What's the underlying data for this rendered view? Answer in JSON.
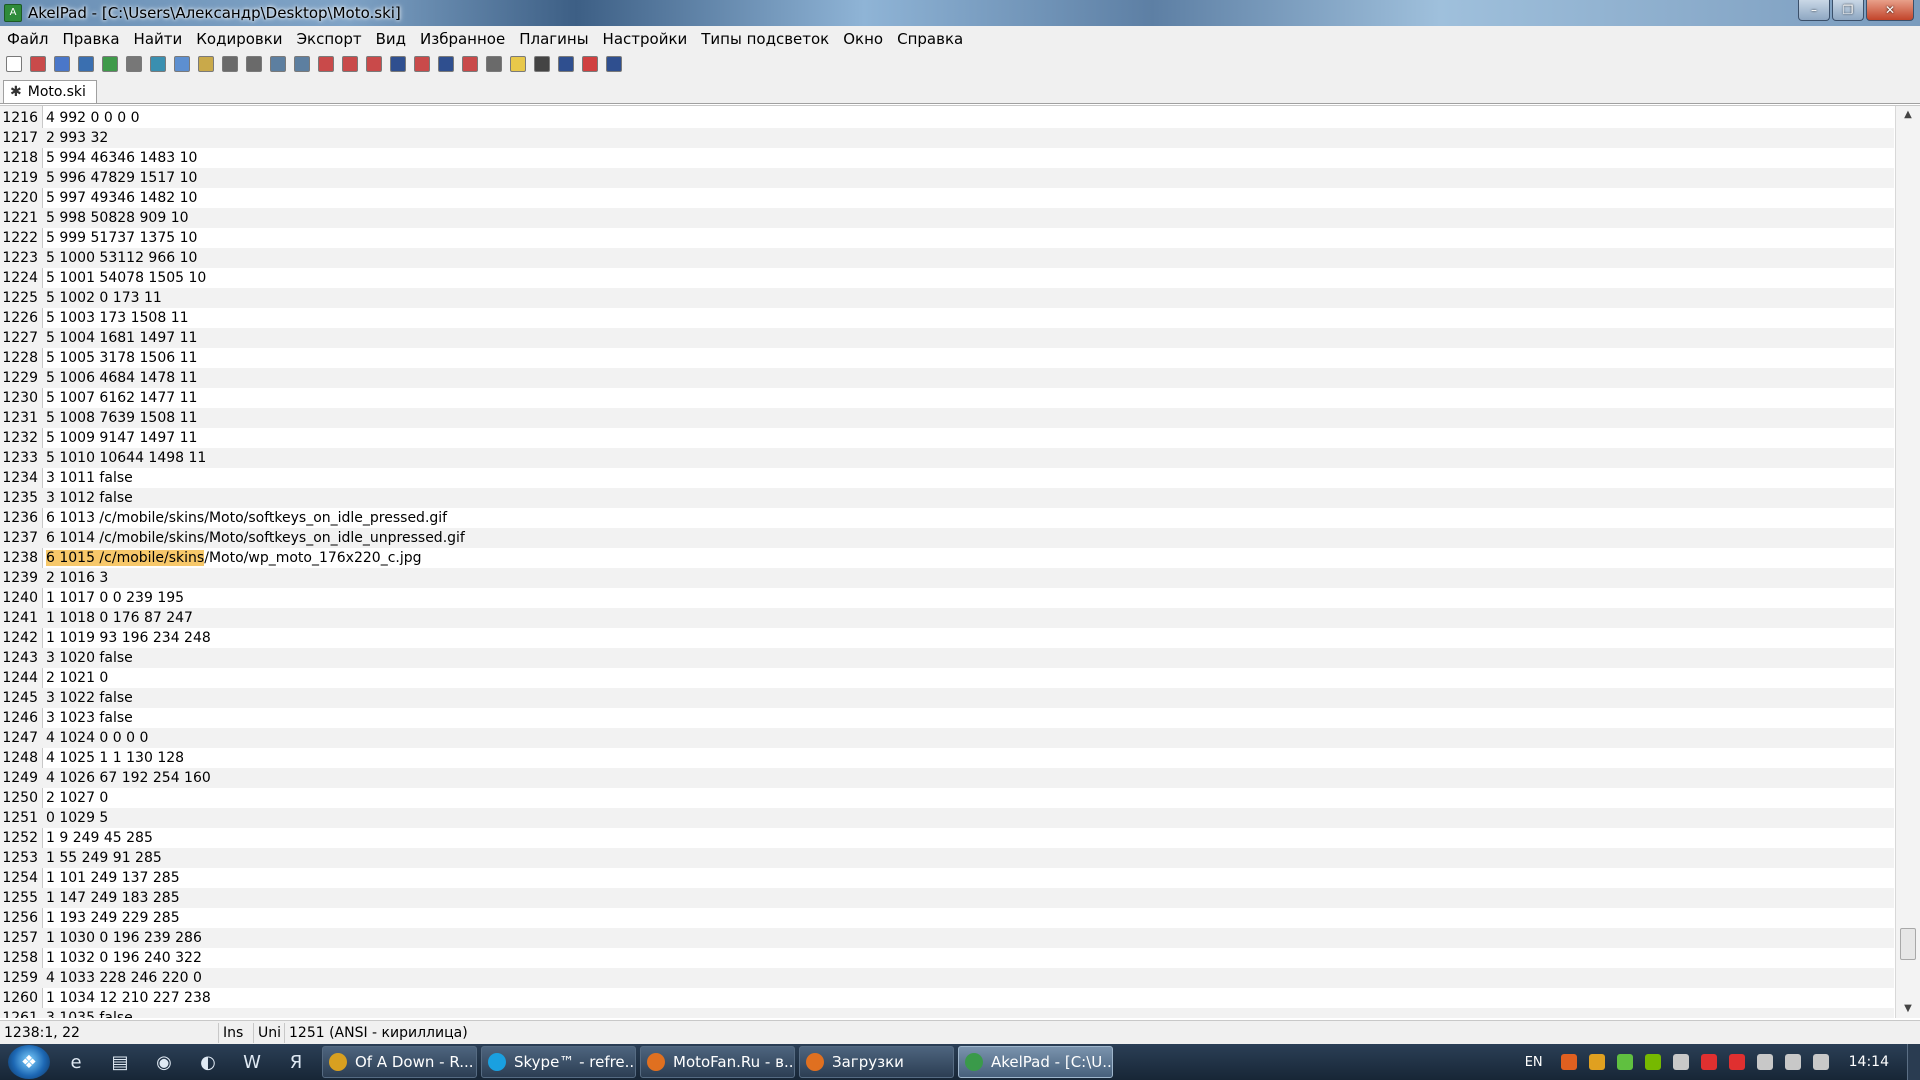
{
  "window": {
    "title": "AkelPad - [C:\\Users\\Александр\\Desktop\\Moto.ski]",
    "controls": [
      "–",
      "❐",
      "✕"
    ]
  },
  "menu": [
    "Файл",
    "Правка",
    "Найти",
    "Кодировки",
    "Экспорт",
    "Вид",
    "Избранное",
    "Плагины",
    "Настройки",
    "Типы подсветок",
    "Окно",
    "Справка"
  ],
  "toolbar": [
    {
      "icon": "new-file-icon",
      "color": "#ffffff"
    },
    {
      "icon": "open-icon",
      "color": "#c94a4a"
    },
    {
      "icon": "reopen-icon",
      "color": "#4a77c9"
    },
    {
      "icon": "save-icon",
      "color": "#3a6fb0"
    },
    {
      "icon": "save-all-icon",
      "color": "#3f9a4a"
    },
    {
      "icon": "print-icon",
      "color": "#777777"
    },
    {
      "icon": "cut-icon",
      "color": "#3a8fb0"
    },
    {
      "icon": "copy-icon",
      "color": "#5d8fd0"
    },
    {
      "icon": "paste-icon",
      "color": "#c9a94a"
    },
    {
      "icon": "undo-icon",
      "color": "#6a6a6a"
    },
    {
      "icon": "redo-icon",
      "color": "#6a6a6a"
    },
    {
      "icon": "find-icon",
      "color": "#5d7fa0"
    },
    {
      "icon": "find-next-icon",
      "color": "#5d7fa0"
    },
    {
      "icon": "replace-icon",
      "color": "#c94a4a"
    },
    {
      "icon": "goto-icon",
      "color": "#c94a4a"
    },
    {
      "icon": "insert-date-icon",
      "color": "#c94a4a"
    },
    {
      "icon": "font-icon",
      "color": "#2f4f8f"
    },
    {
      "icon": "color-icon",
      "color": "#c94a4a"
    },
    {
      "icon": "wrap-icon",
      "color": "#2f4f8f"
    },
    {
      "icon": "read-only-icon",
      "color": "#c94a4a"
    },
    {
      "icon": "settings-icon",
      "color": "#6a6a6a"
    },
    {
      "icon": "bulb-icon",
      "color": "#e8c84a"
    },
    {
      "icon": "plugin-icon",
      "color": "#444444"
    },
    {
      "icon": "script-icon",
      "color": "#2f4f8f"
    },
    {
      "icon": "zoom-in-icon",
      "color": "#d04040"
    },
    {
      "icon": "zoom-out-icon",
      "color": "#2f4f8f"
    }
  ],
  "tab": {
    "label": "Moto.ski"
  },
  "editor": {
    "lines": [
      {
        "n": "1216",
        "text": "4 992 0 0 0 0"
      },
      {
        "n": "1217",
        "text": "2 993 32"
      },
      {
        "n": "1218",
        "text": "5 994 46346 1483 10"
      },
      {
        "n": "1219",
        "text": "5 996 47829 1517 10"
      },
      {
        "n": "1220",
        "text": "5 997 49346 1482 10"
      },
      {
        "n": "1221",
        "text": "5 998 50828 909 10"
      },
      {
        "n": "1222",
        "text": "5 999 51737 1375 10"
      },
      {
        "n": "1223",
        "text": "5 1000 53112 966 10"
      },
      {
        "n": "1224",
        "text": "5 1001 54078 1505 10"
      },
      {
        "n": "1225",
        "text": "5 1002 0 173 11"
      },
      {
        "n": "1226",
        "text": "5 1003 173 1508 11"
      },
      {
        "n": "1227",
        "text": "5 1004 1681 1497 11"
      },
      {
        "n": "1228",
        "text": "5 1005 3178 1506 11"
      },
      {
        "n": "1229",
        "text": "5 1006 4684 1478 11"
      },
      {
        "n": "1230",
        "text": "5 1007 6162 1477 11"
      },
      {
        "n": "1231",
        "text": "5 1008 7639 1508 11"
      },
      {
        "n": "1232",
        "text": "5 1009 9147 1497 11"
      },
      {
        "n": "1233",
        "text": "5 1010 10644 1498 11"
      },
      {
        "n": "1234",
        "text": "3 1011 false"
      },
      {
        "n": "1235",
        "text": "3 1012 false"
      },
      {
        "n": "1236",
        "text": "6 1013 /c/mobile/skins/Moto/softkeys_on_idle_pressed.gif"
      },
      {
        "n": "1237",
        "text": "6 1014 /c/mobile/skins/Moto/softkeys_on_idle_unpressed.gif"
      },
      {
        "n": "1238",
        "text": "/Moto/wp_moto_176x220_c.jpg",
        "selected": "6 1015 /c/mobile/skins"
      },
      {
        "n": "1239",
        "text": "2 1016 3"
      },
      {
        "n": "1240",
        "text": "1 1017 0 0 239 195"
      },
      {
        "n": "1241",
        "text": "1 1018 0 176 87 247"
      },
      {
        "n": "1242",
        "text": "1 1019 93 196 234 248"
      },
      {
        "n": "1243",
        "text": "3 1020 false"
      },
      {
        "n": "1244",
        "text": "2 1021 0"
      },
      {
        "n": "1245",
        "text": "3 1022 false"
      },
      {
        "n": "1246",
        "text": "3 1023 false"
      },
      {
        "n": "1247",
        "text": "4 1024 0 0 0 0"
      },
      {
        "n": "1248",
        "text": "4 1025 1 1 130 128"
      },
      {
        "n": "1249",
        "text": "4 1026 67 192 254 160"
      },
      {
        "n": "1250",
        "text": "2 1027 0"
      },
      {
        "n": "1251",
        "text": "0 1029 5"
      },
      {
        "n": "1252",
        "text": "1 9 249 45 285"
      },
      {
        "n": "1253",
        "text": "1 55 249 91 285"
      },
      {
        "n": "1254",
        "text": "1 101 249 137 285"
      },
      {
        "n": "1255",
        "text": "1 147 249 183 285"
      },
      {
        "n": "1256",
        "text": "1 193 249 229 285"
      },
      {
        "n": "1257",
        "text": "1 1030 0 196 239 286"
      },
      {
        "n": "1258",
        "text": "1 1032 0 196 240 322"
      },
      {
        "n": "1259",
        "text": "4 1033 228 246 220 0"
      },
      {
        "n": "1260",
        "text": "1 1034 12 210 227 238"
      },
      {
        "n": "1261",
        "text": "3 1035 false"
      }
    ]
  },
  "status": {
    "position": "1238:1, 22",
    "mode": "Ins",
    "unicode": "Uni",
    "codepage": "1251  (ANSI - кириллица)"
  },
  "taskbar": {
    "pinned": [
      {
        "icon": "ie-icon",
        "glyph": "e"
      },
      {
        "icon": "explorer-icon",
        "glyph": "▤"
      },
      {
        "icon": "media-player-icon",
        "glyph": "◉"
      },
      {
        "icon": "firefox-icon",
        "glyph": "◐"
      },
      {
        "icon": "word-icon",
        "glyph": "W"
      },
      {
        "icon": "yandex-icon",
        "glyph": "Я"
      }
    ],
    "tasks": [
      {
        "label": "Of A Down - R...",
        "color": "#d8a020",
        "active": false
      },
      {
        "label": "Skype™ - refre...",
        "color": "#1aa0e0",
        "active": false
      },
      {
        "label": "MotoFan.Ru - в...",
        "color": "#e07020",
        "active": false
      },
      {
        "label": "Загрузки",
        "color": "#e07020",
        "active": false
      },
      {
        "label": "AkelPad - [C:\\U...",
        "color": "#3a9a4a",
        "active": true
      }
    ],
    "lang": "EN",
    "clock": "14:14",
    "tray": [
      {
        "icon": "warning-icon",
        "color": "#e06020"
      },
      {
        "icon": "pause-icon",
        "color": "#e0a020"
      },
      {
        "icon": "shield-icon",
        "color": "#60c040"
      },
      {
        "icon": "nvidia-icon",
        "color": "#76b900"
      },
      {
        "icon": "network-icon",
        "color": "#c8c8c8"
      },
      {
        "icon": "volume-icon",
        "color": "#e03030"
      },
      {
        "icon": "antivirus-icon",
        "color": "#e03030"
      },
      {
        "icon": "power-icon",
        "color": "#c8c8c8"
      },
      {
        "icon": "monitor-icon",
        "color": "#c8c8c8"
      },
      {
        "icon": "speaker-icon",
        "color": "#c8c8c8"
      }
    ]
  }
}
